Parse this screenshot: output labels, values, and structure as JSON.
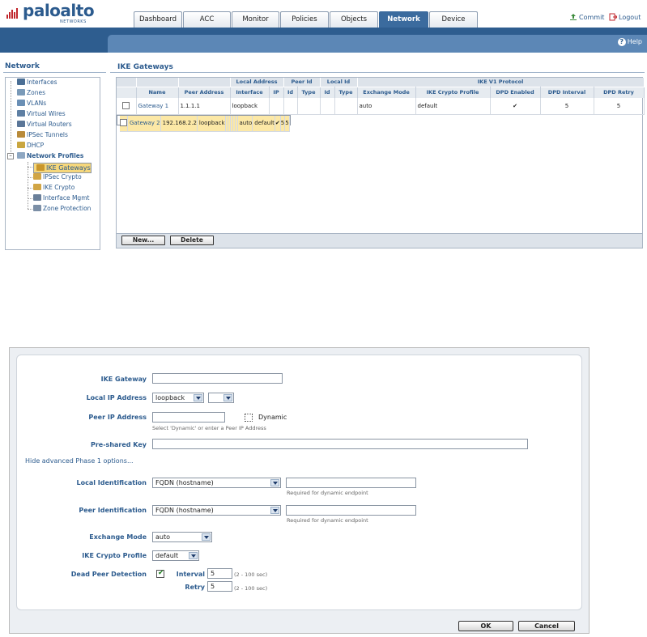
{
  "header": {
    "brand": "paloalto",
    "brand_sub": "NETWORKS",
    "tabs": [
      "Dashboard",
      "ACC",
      "Monitor",
      "Policies",
      "Objects",
      "Network",
      "Device"
    ],
    "active_tab": "Network",
    "commit": "Commit",
    "logout": "Logout",
    "help": "Help"
  },
  "nav": {
    "title": "Network",
    "items": [
      {
        "label": "Interfaces",
        "icon": "interfaces-icon"
      },
      {
        "label": "Zones",
        "icon": "zones-icon"
      },
      {
        "label": "VLANs",
        "icon": "vlans-icon"
      },
      {
        "label": "Virtual Wires",
        "icon": "virtual-wires-icon"
      },
      {
        "label": "Virtual Routers",
        "icon": "virtual-routers-icon"
      },
      {
        "label": "IPSec Tunnels",
        "icon": "ipsec-tunnels-icon"
      },
      {
        "label": "DHCP",
        "icon": "dhcp-icon"
      },
      {
        "label": "Network Profiles",
        "icon": "network-profiles-icon"
      },
      {
        "label": "IKE Gateways",
        "icon": "ike-gateways-icon"
      },
      {
        "label": "IPSec Crypto",
        "icon": "ipsec-crypto-icon"
      },
      {
        "label": "IKE Crypto",
        "icon": "ike-crypto-icon"
      },
      {
        "label": "Interface Mgmt",
        "icon": "interface-mgmt-icon"
      },
      {
        "label": "Zone Protection",
        "icon": "zone-protection-icon"
      }
    ]
  },
  "list": {
    "title": "IKE Gateways",
    "group_headers": {
      "local_address": "Local Address",
      "peer_id": "Peer Id",
      "local_id": "Local Id",
      "ike_v1": "IKE V1 Protocol"
    },
    "columns": [
      "Name",
      "Peer Address",
      "Interface",
      "IP",
      "Id",
      "Type",
      "Id",
      "Type",
      "Exchange Mode",
      "IKE Crypto Profile",
      "DPD Enabled",
      "DPD Interval",
      "DPD Retry"
    ],
    "rows": [
      {
        "name": "Gateway 1",
        "peer_address": "1.1.1.1",
        "interface": "loopback",
        "ip": "",
        "peer_id": "",
        "peer_type": "",
        "local_id": "",
        "local_type": "",
        "exchange_mode": "auto",
        "crypto_profile": "default",
        "dpd_enabled": "✔",
        "dpd_interval": "5",
        "dpd_retry": "5"
      },
      {
        "name": "Gateway 2",
        "peer_address": "192.168.2.2",
        "interface": "loopback",
        "ip": "",
        "peer_id": "",
        "peer_type": "",
        "local_id": "",
        "local_type": "",
        "exchange_mode": "auto",
        "crypto_profile": "default",
        "dpd_enabled": "✔",
        "dpd_interval": "5",
        "dpd_retry": "5"
      }
    ],
    "new_button": "New...",
    "delete_button": "Delete"
  },
  "dialog": {
    "ike_gateway_label": "IKE Gateway",
    "ike_gateway_value": "",
    "local_ip_label": "Local IP Address",
    "local_ip_interface": "loopback",
    "local_ip_address": "",
    "peer_ip_label": "Peer IP Address",
    "peer_ip_value": "",
    "dynamic_label": "Dynamic",
    "peer_ip_hint": "Select 'Dynamic' or enter a Peer IP Address",
    "psk_label": "Pre-shared Key",
    "psk_value": "",
    "advanced_link": "Hide advanced Phase 1 options...",
    "local_id_label": "Local Identification",
    "local_id_type": "FQDN (hostname)",
    "local_id_value": "",
    "local_id_hint": "Required for dynamic endpoint",
    "peer_id_label": "Peer Identification",
    "peer_id_type": "FQDN (hostname)",
    "peer_id_value": "",
    "peer_id_hint": "Required for dynamic endpoint",
    "exchange_mode_label": "Exchange Mode",
    "exchange_mode_value": "auto",
    "crypto_profile_label": "IKE Crypto Profile",
    "crypto_profile_value": "default",
    "dpd_label": "Dead Peer Detection",
    "interval_label": "Interval",
    "interval_value": "5",
    "interval_hint": "(2 - 100 sec)",
    "retry_label": "Retry",
    "retry_value": "5",
    "retry_hint": "(2 - 100 sec)",
    "ok_button": "OK",
    "cancel_button": "Cancel"
  },
  "colors": {
    "brand_blue": "#2c5b8e",
    "band_blue": "#2e5d8f",
    "selected_row": "#fce8a6",
    "logo_red": "#c1272d"
  }
}
